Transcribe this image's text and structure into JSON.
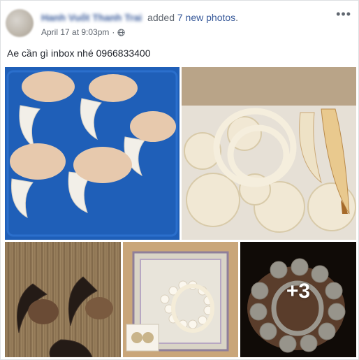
{
  "post": {
    "author": "Hanh Vuốt Thanh Trai",
    "action_prefix": "added",
    "action_link": "7 new photos",
    "action_suffix": ".",
    "timestamp": "April 17 at 9:03pm",
    "separator": "·",
    "privacy_icon": "globe-icon",
    "more_icon": "more-options-icon",
    "text": "Ae cần gì inbox nhé 0966833400"
  },
  "photos": {
    "overflow_label": "+3"
  },
  "colors": {
    "link": "#365899",
    "meta": "#606770",
    "text": "#1d2129"
  }
}
